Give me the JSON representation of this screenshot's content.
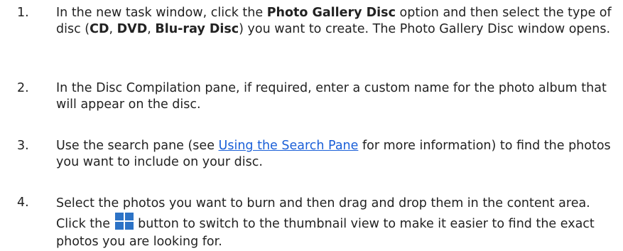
{
  "steps": [
    {
      "number": "1.",
      "text_a": "In the new task window, click the ",
      "bold_a": "Photo Gallery Disc",
      "text_b": " option and then select the type of disc (",
      "bold_b": "CD",
      "sep_1": ", ",
      "bold_c": "DVD",
      "sep_2": ", ",
      "bold_d": "Blu-ray Disc",
      "text_c": ") you want to create. The Photo Gallery Disc window opens."
    },
    {
      "number": "2.",
      "text": "In the Disc Compilation pane, if required, enter a custom name for the photo album that will appear on the disc."
    },
    {
      "number": "3.",
      "text_a": "Use the search pane (see ",
      "link": "Using the Search Pane",
      "text_b": " for more information) to find the photos you want to include on your disc."
    },
    {
      "number": "4.",
      "text_a": "Select the photos you want to burn and then drag and drop them in the content area. Click the ",
      "icon": "thumbnail-view-icon",
      "text_b": " button to switch to the thumbnail view to make it easier to find the exact photos you are looking for."
    }
  ],
  "colors": {
    "text": "#222222",
    "link": "#1a5fd8",
    "icon": "#2d73c6"
  }
}
